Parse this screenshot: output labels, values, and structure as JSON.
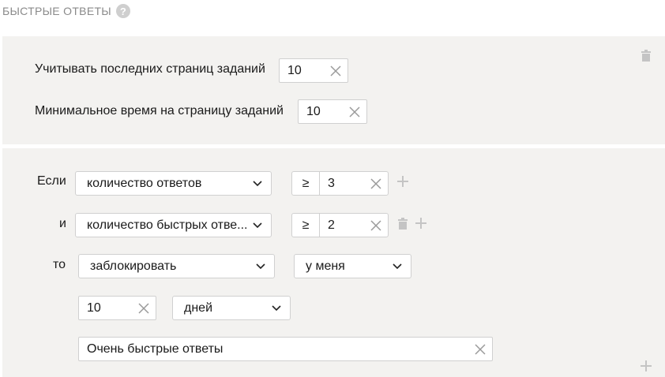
{
  "section": {
    "title": "БЫСТРЫЕ ОТВЕТЫ",
    "help": "?"
  },
  "settings": {
    "last_pages_label": "Учитывать последних страниц заданий",
    "last_pages_value": "10",
    "min_time_label": "Минимальное время на страницу заданий",
    "min_time_value": "10"
  },
  "rule": {
    "if_label": "Если",
    "condition1": {
      "field": "количество ответов",
      "operator": "≥",
      "value": "3"
    },
    "and_label": "и",
    "condition2": {
      "field": "количество быстрых отве...",
      "operator": "≥",
      "value": "2"
    },
    "then_label": "то",
    "action": "заблокировать",
    "scope": "у меня",
    "duration_value": "10",
    "duration_unit": "дней",
    "reason": "Очень быстрые ответы"
  },
  "colors": {
    "panel_bg": "#f3f2f0",
    "icon_gray": "#c4c4c4"
  },
  "icons": [
    "help-icon",
    "trash-icon",
    "plus-icon",
    "clear-icon",
    "chevron-down-icon"
  ]
}
